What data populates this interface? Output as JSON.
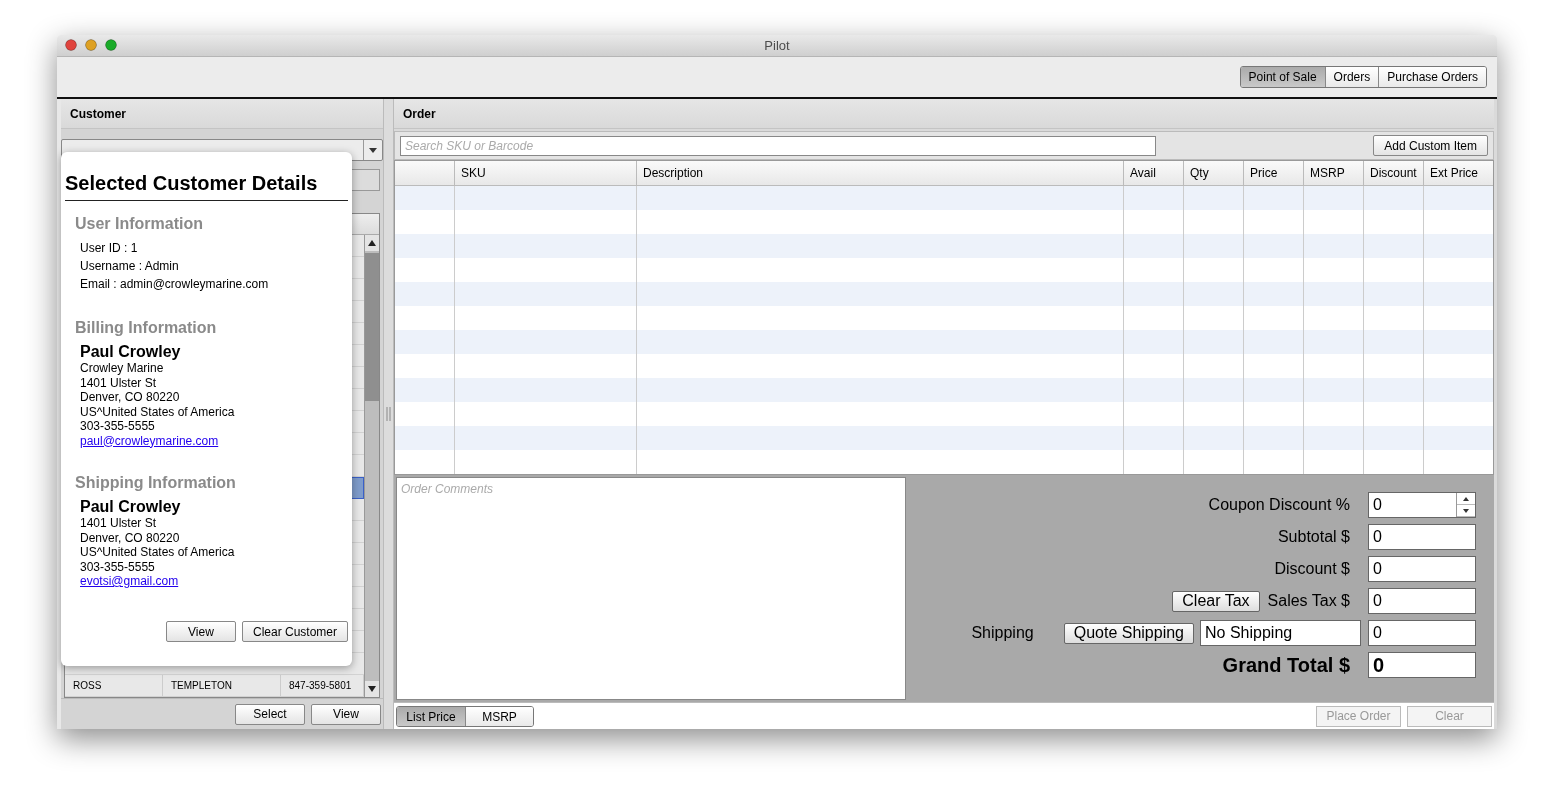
{
  "window": {
    "title": "Pilot"
  },
  "tabs": [
    {
      "label": "Point of Sale",
      "selected": true
    },
    {
      "label": "Orders",
      "selected": false
    },
    {
      "label": "Purchase Orders",
      "selected": false
    }
  ],
  "customer_panel": {
    "title": "Customer",
    "table": {
      "rows": [
        {
          "selected": false
        },
        {
          "selected": false
        },
        {
          "selected": false
        },
        {
          "selected": false
        },
        {
          "selected": false
        },
        {
          "selected": false
        },
        {
          "selected": false
        },
        {
          "selected": false
        },
        {
          "selected": false
        },
        {
          "selected": false
        },
        {
          "selected": false
        },
        {
          "selected": true
        },
        {
          "selected": false
        },
        {
          "selected": false
        },
        {
          "selected": false
        },
        {
          "selected": false
        },
        {
          "selected": false
        },
        {
          "selected": false
        },
        {
          "selected": false
        },
        {
          "selected": false
        },
        {
          "selected": false,
          "cells": [
            "ROSS",
            "TEMPLETON",
            "847-359-5801"
          ]
        }
      ]
    },
    "buttons": [
      "Select",
      "View"
    ]
  },
  "customer_details": {
    "title": "Selected Customer Details",
    "sections": [
      {
        "kind": "user",
        "heading": "User Information",
        "lines": [
          "User ID : 1",
          "Username : Admin",
          "Email : admin@crowleymarine.com"
        ]
      },
      {
        "kind": "address",
        "heading": "Billing Information",
        "name": "Paul Crowley",
        "lines": [
          "Crowley Marine",
          "1401 Ulster St",
          "Denver, CO 80220",
          "US^United States of America",
          "303-355-5555"
        ],
        "email": "paul@crowleymarine.com"
      },
      {
        "kind": "address",
        "heading": "Shipping Information",
        "name": "Paul Crowley",
        "lines": [
          "1401 Ulster St",
          "Denver, CO 80220",
          "US^United States of America",
          "303-355-5555"
        ],
        "email": "evotsi@gmail.com"
      }
    ],
    "buttons": [
      "View",
      "Clear Customer"
    ]
  },
  "order_panel": {
    "title": "Order",
    "search": {
      "placeholder": "Search SKU or Barcode"
    },
    "add_button": "Add Custom Item",
    "table": {
      "columns": [
        "SKU",
        "Description",
        "Avail",
        "Qty",
        "Price",
        "MSRP",
        "Discount",
        "Ext Price"
      ]
    },
    "comments": {
      "placeholder": "Order Comments"
    },
    "totals": [
      {
        "kind": "spinner",
        "label": "Coupon Discount %",
        "value": "0"
      },
      {
        "kind": "field",
        "label": "Subtotal $",
        "value": "0"
      },
      {
        "kind": "field",
        "label": "Discount $",
        "value": "0"
      },
      {
        "kind": "tax",
        "button": "Clear Tax",
        "label": "Sales Tax $",
        "value": "0"
      },
      {
        "kind": "shipping",
        "label": "Shipping",
        "button": "Quote Shipping",
        "method": "No Shipping",
        "value": "0"
      },
      {
        "kind": "grand",
        "label": "Grand Total $",
        "value": "0"
      }
    ],
    "price_modes": [
      {
        "label": "List Price",
        "selected": true
      },
      {
        "label": "MSRP",
        "selected": false
      }
    ],
    "actions": [
      {
        "label": "Place Order",
        "disabled": true
      },
      {
        "label": "Clear",
        "disabled": true
      }
    ]
  }
}
